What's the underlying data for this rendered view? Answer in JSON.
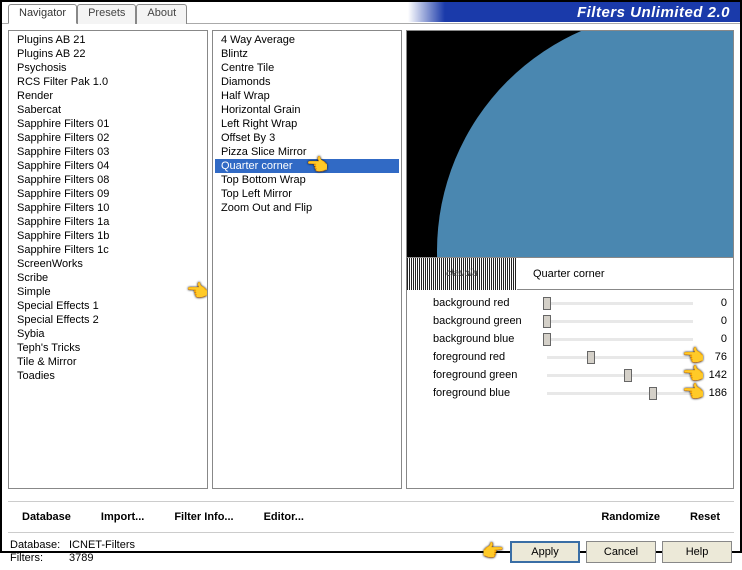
{
  "header": {
    "title": "Filters Unlimited 2.0"
  },
  "tabs": [
    {
      "label": "Navigator",
      "active": true
    },
    {
      "label": "Presets",
      "active": false
    },
    {
      "label": "About",
      "active": false
    }
  ],
  "leftList": {
    "items": [
      "Plugins AB 21",
      "Plugins AB 22",
      "Psychosis",
      "RCS Filter Pak 1.0",
      "Render",
      "Sabercat",
      "Sapphire Filters 01",
      "Sapphire Filters 02",
      "Sapphire Filters 03",
      "Sapphire Filters 04",
      "Sapphire Filters 08",
      "Sapphire Filters 09",
      "Sapphire Filters 10",
      "Sapphire Filters 1a",
      "Sapphire Filters 1b",
      "Sapphire Filters 1c",
      "ScreenWorks",
      "Scribe",
      "Simple",
      "Special Effects 1",
      "Special Effects 2",
      "Sybia",
      "Teph's Tricks",
      "Tile & Mirror",
      "Toadies"
    ],
    "highlightIndex": 18
  },
  "midList": {
    "items": [
      "4 Way Average",
      "Blintz",
      "Centre Tile",
      "Diamonds",
      "Half Wrap",
      "Horizontal Grain",
      "Left Right Wrap",
      "Offset By 3",
      "Pizza Slice Mirror",
      "Quarter corner",
      "Top Bottom Wrap",
      "Top Left Mirror",
      "Zoom Out and Flip"
    ],
    "selectedIndex": 9
  },
  "filterName": "Quarter corner",
  "sliders": [
    {
      "label": "background red",
      "value": 0,
      "max": 255,
      "hand": false
    },
    {
      "label": "background green",
      "value": 0,
      "max": 255,
      "hand": false
    },
    {
      "label": "background blue",
      "value": 0,
      "max": 255,
      "hand": false
    },
    {
      "label": "foreground red",
      "value": 76,
      "max": 255,
      "hand": true
    },
    {
      "label": "foreground green",
      "value": 142,
      "max": 255,
      "hand": true
    },
    {
      "label": "foreground blue",
      "value": 186,
      "max": 255,
      "hand": true
    }
  ],
  "buttonRowLeft": [
    "Database",
    "Import...",
    "Filter Info...",
    "Editor..."
  ],
  "buttonRowRight": [
    "Randomize",
    "Reset"
  ],
  "footer": {
    "dbLabel": "Database:",
    "dbValue": "ICNET-Filters",
    "filLabel": "Filters:",
    "filValue": "3789",
    "apply": "Apply",
    "cancel": "Cancel",
    "help": "Help"
  }
}
